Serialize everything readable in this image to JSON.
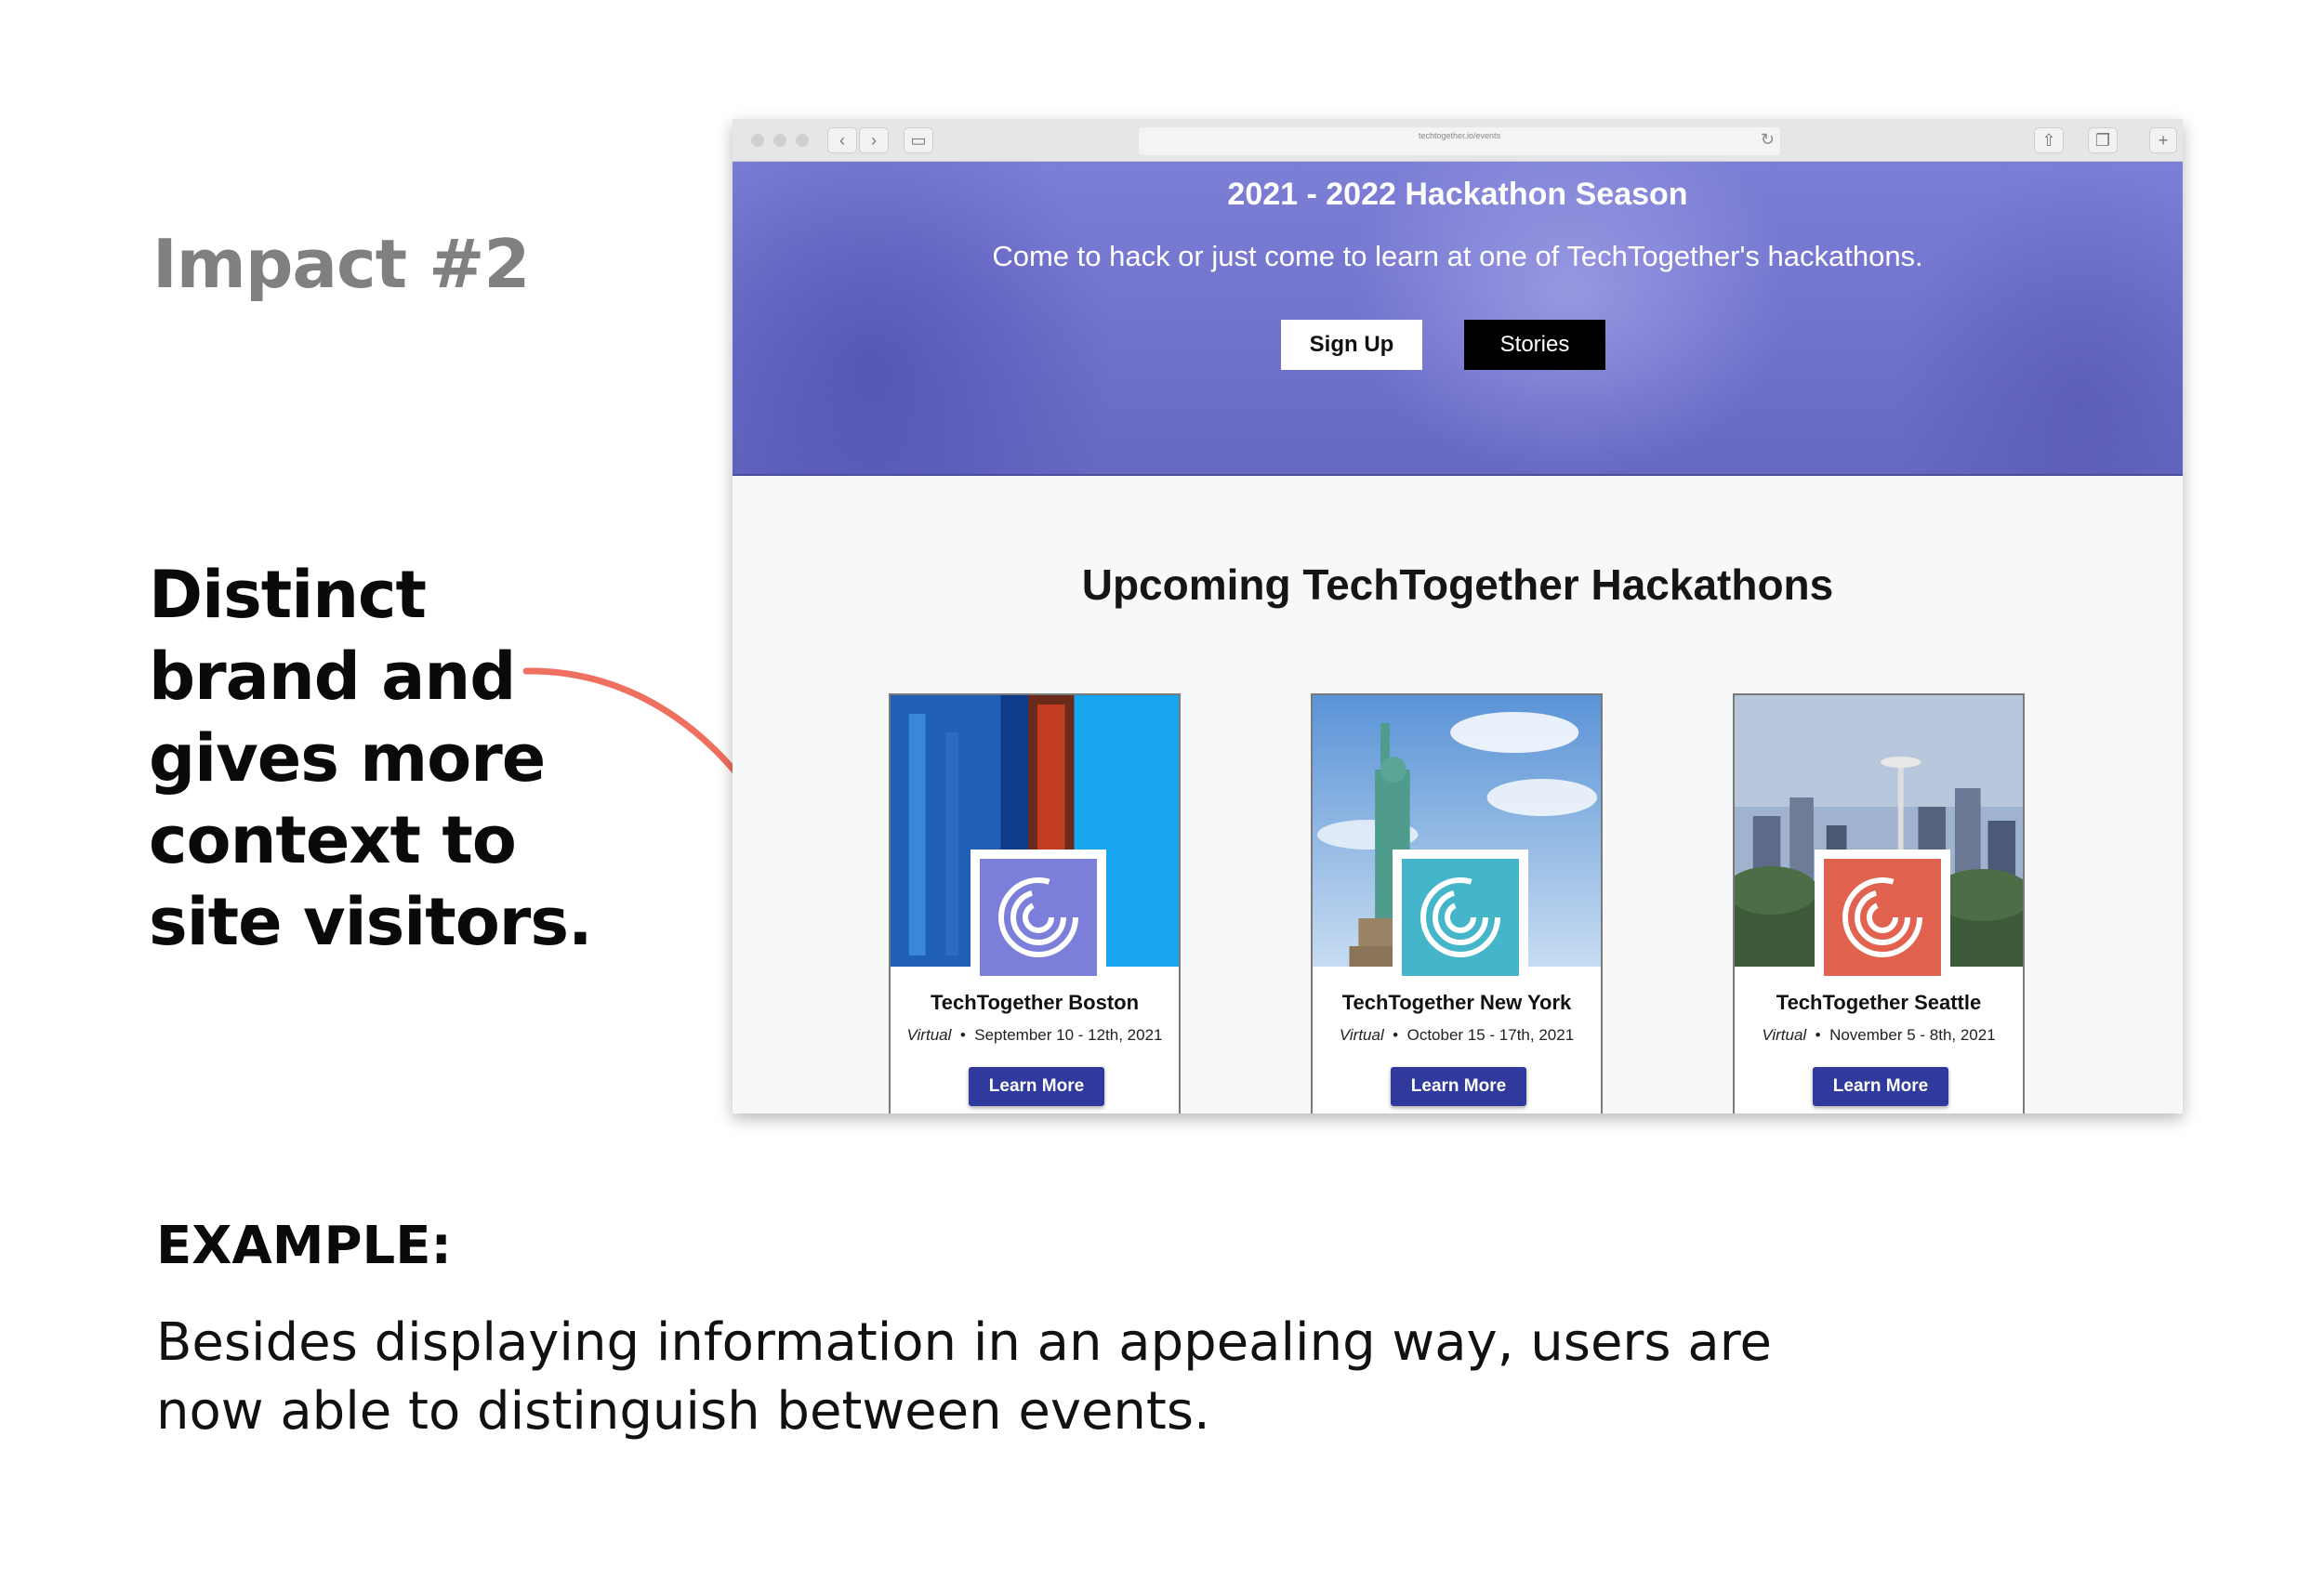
{
  "slide": {
    "impact_title": "Impact #2",
    "tagline": "Distinct brand and gives more context to site visitors.",
    "example_label": "EXAMPLE:",
    "example_body": "Besides displaying information in an appealing way, users are now able to distinguish between events."
  },
  "browser": {
    "address": "techtogether.io/events"
  },
  "hero": {
    "title": "2021 - 2022 Hackathon Season",
    "subtitle": "Come to hack or just come to learn at one of TechTogether's hackathons.",
    "signup_label": "Sign Up",
    "stories_label": "Stories"
  },
  "section_title": "Upcoming TechTogether Hackathons",
  "events": [
    {
      "name": "TechTogether Boston",
      "mode": "Virtual",
      "dates": "September 10 - 12th, 2021",
      "button": "Learn More",
      "logo_color": "#7b7fd9"
    },
    {
      "name": "TechTogether New York",
      "mode": "Virtual",
      "dates": "October 15 - 17th, 2021",
      "button": "Learn More",
      "logo_color": "#45b6c9"
    },
    {
      "name": "TechTogether Seattle",
      "mode": "Virtual",
      "dates": "November 5 - 8th, 2021",
      "button": "Learn More",
      "logo_color": "#e0624f"
    }
  ],
  "colors": {
    "accent_arrow": "#f07060",
    "hero_overlay": "#7072cc",
    "button_blue": "#2f3a9c"
  }
}
